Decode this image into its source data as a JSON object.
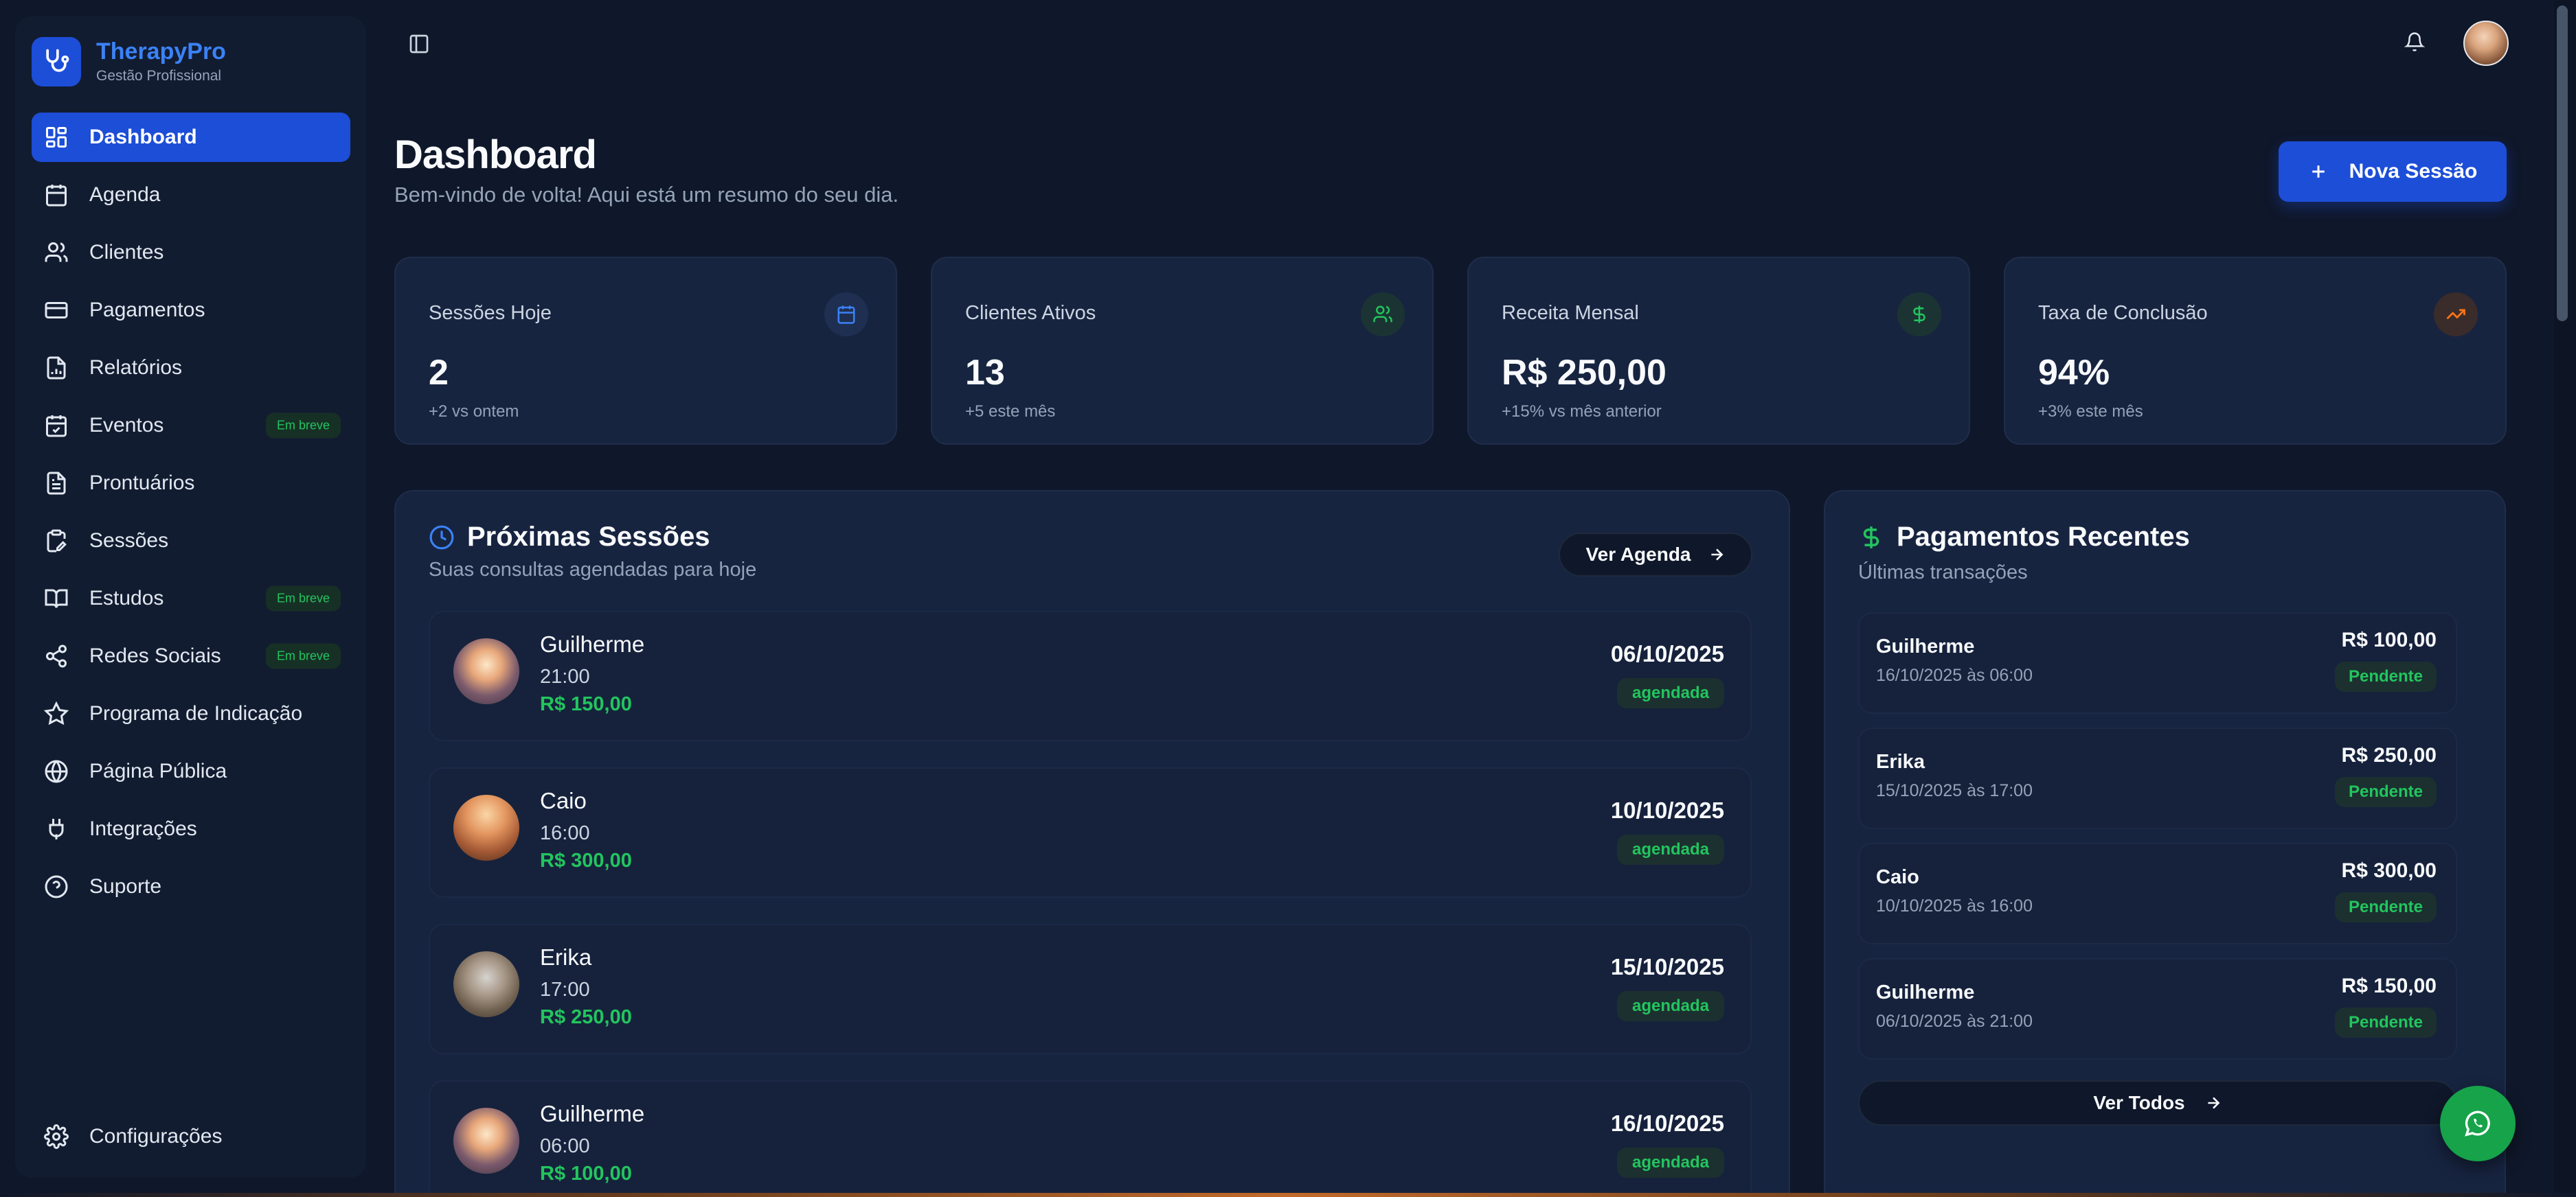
{
  "brand": {
    "name": "TherapyPro",
    "subtitle": "Gestão Profissional"
  },
  "sidebar": {
    "items": [
      {
        "label": "Dashboard",
        "icon": "dashboard-grid-icon",
        "active": true
      },
      {
        "label": "Agenda",
        "icon": "calendar-icon"
      },
      {
        "label": "Clientes",
        "icon": "users-icon"
      },
      {
        "label": "Pagamentos",
        "icon": "credit-card-icon"
      },
      {
        "label": "Relatórios",
        "icon": "report-chart-icon"
      },
      {
        "label": "Eventos",
        "icon": "calendar-check-icon",
        "badge": "Em breve"
      },
      {
        "label": "Prontuários",
        "icon": "file-text-icon"
      },
      {
        "label": "Sessões",
        "icon": "clipboard-edit-icon"
      },
      {
        "label": "Estudos",
        "icon": "book-open-icon",
        "badge": "Em breve"
      },
      {
        "label": "Redes Sociais",
        "icon": "share-icon",
        "badge": "Em breve"
      },
      {
        "label": "Programa de Indicação",
        "icon": "star-icon"
      },
      {
        "label": "Página Pública",
        "icon": "globe-icon"
      },
      {
        "label": "Integrações",
        "icon": "plug-icon"
      },
      {
        "label": "Suporte",
        "icon": "help-circle-icon"
      }
    ],
    "settings_label": "Configurações"
  },
  "header": {
    "title": "Dashboard",
    "subtitle": "Bem-vindo de volta! Aqui está um resumo do seu dia.",
    "new_session_label": "Nova Sessão"
  },
  "stats": [
    {
      "label": "Sessões Hoje",
      "value": "2",
      "delta": "+2 vs ontem",
      "icon": "calendar-icon",
      "color": "#3b82f6"
    },
    {
      "label": "Clientes Ativos",
      "value": "13",
      "delta": "+5 este mês",
      "icon": "users-icon",
      "color": "#22c55e"
    },
    {
      "label": "Receita Mensal",
      "value": "R$ 250,00",
      "delta": "+15% vs mês anterior",
      "icon": "dollar-icon",
      "color": "#22c55e"
    },
    {
      "label": "Taxa de Conclusão",
      "value": "94%",
      "delta": "+3% este mês",
      "icon": "trending-up-icon",
      "color": "#f97316"
    }
  ],
  "sessions_panel": {
    "title": "Próximas Sessões",
    "subtitle": "Suas consultas agendadas para hoje",
    "button_label": "Ver Agenda",
    "sessions": [
      {
        "name": "Guilherme",
        "time": "21:00",
        "price": "R$ 150,00",
        "date": "06/10/2025",
        "status": "agendada"
      },
      {
        "name": "Caio",
        "time": "16:00",
        "price": "R$ 300,00",
        "date": "10/10/2025",
        "status": "agendada"
      },
      {
        "name": "Erika",
        "time": "17:00",
        "price": "R$ 250,00",
        "date": "15/10/2025",
        "status": "agendada"
      },
      {
        "name": "Guilherme",
        "time": "06:00",
        "price": "R$ 100,00",
        "date": "16/10/2025",
        "status": "agendada"
      }
    ]
  },
  "payments_panel": {
    "title": "Pagamentos Recentes",
    "subtitle": "Últimas transações",
    "button_label": "Ver Todos",
    "payments": [
      {
        "name": "Guilherme",
        "datetime": "16/10/2025 às 06:00",
        "amount": "R$ 100,00",
        "status": "Pendente"
      },
      {
        "name": "Erika",
        "datetime": "15/10/2025 às 17:00",
        "amount": "R$ 250,00",
        "status": "Pendente"
      },
      {
        "name": "Caio",
        "datetime": "10/10/2025 às 16:00",
        "amount": "R$ 300,00",
        "status": "Pendente"
      },
      {
        "name": "Guilherme",
        "datetime": "06/10/2025 às 21:00",
        "amount": "R$ 150,00",
        "status": "Pendente"
      }
    ]
  },
  "colors": {
    "accent": "#1d4ed8",
    "brand": "#3b82f6",
    "success": "#22c55e",
    "background": "#0f172a",
    "card": "#172440"
  }
}
